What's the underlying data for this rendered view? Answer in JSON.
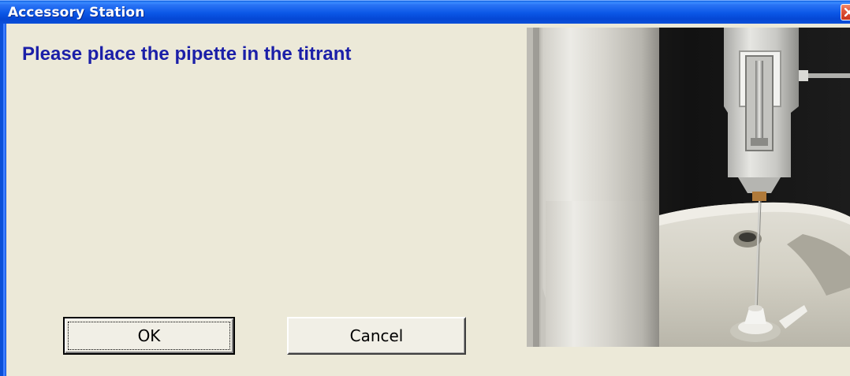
{
  "window": {
    "title": "Accessory Station"
  },
  "dialog": {
    "message": "Please place the pipette in the titrant",
    "message_color": "#1b1fa8",
    "ok_label": "OK",
    "cancel_label": "Cancel"
  },
  "icons": {
    "close": "close-icon"
  },
  "colors": {
    "titlebar": "#0a56e6",
    "close_button": "#e0553a",
    "dialog_background": "#ece9d8"
  }
}
